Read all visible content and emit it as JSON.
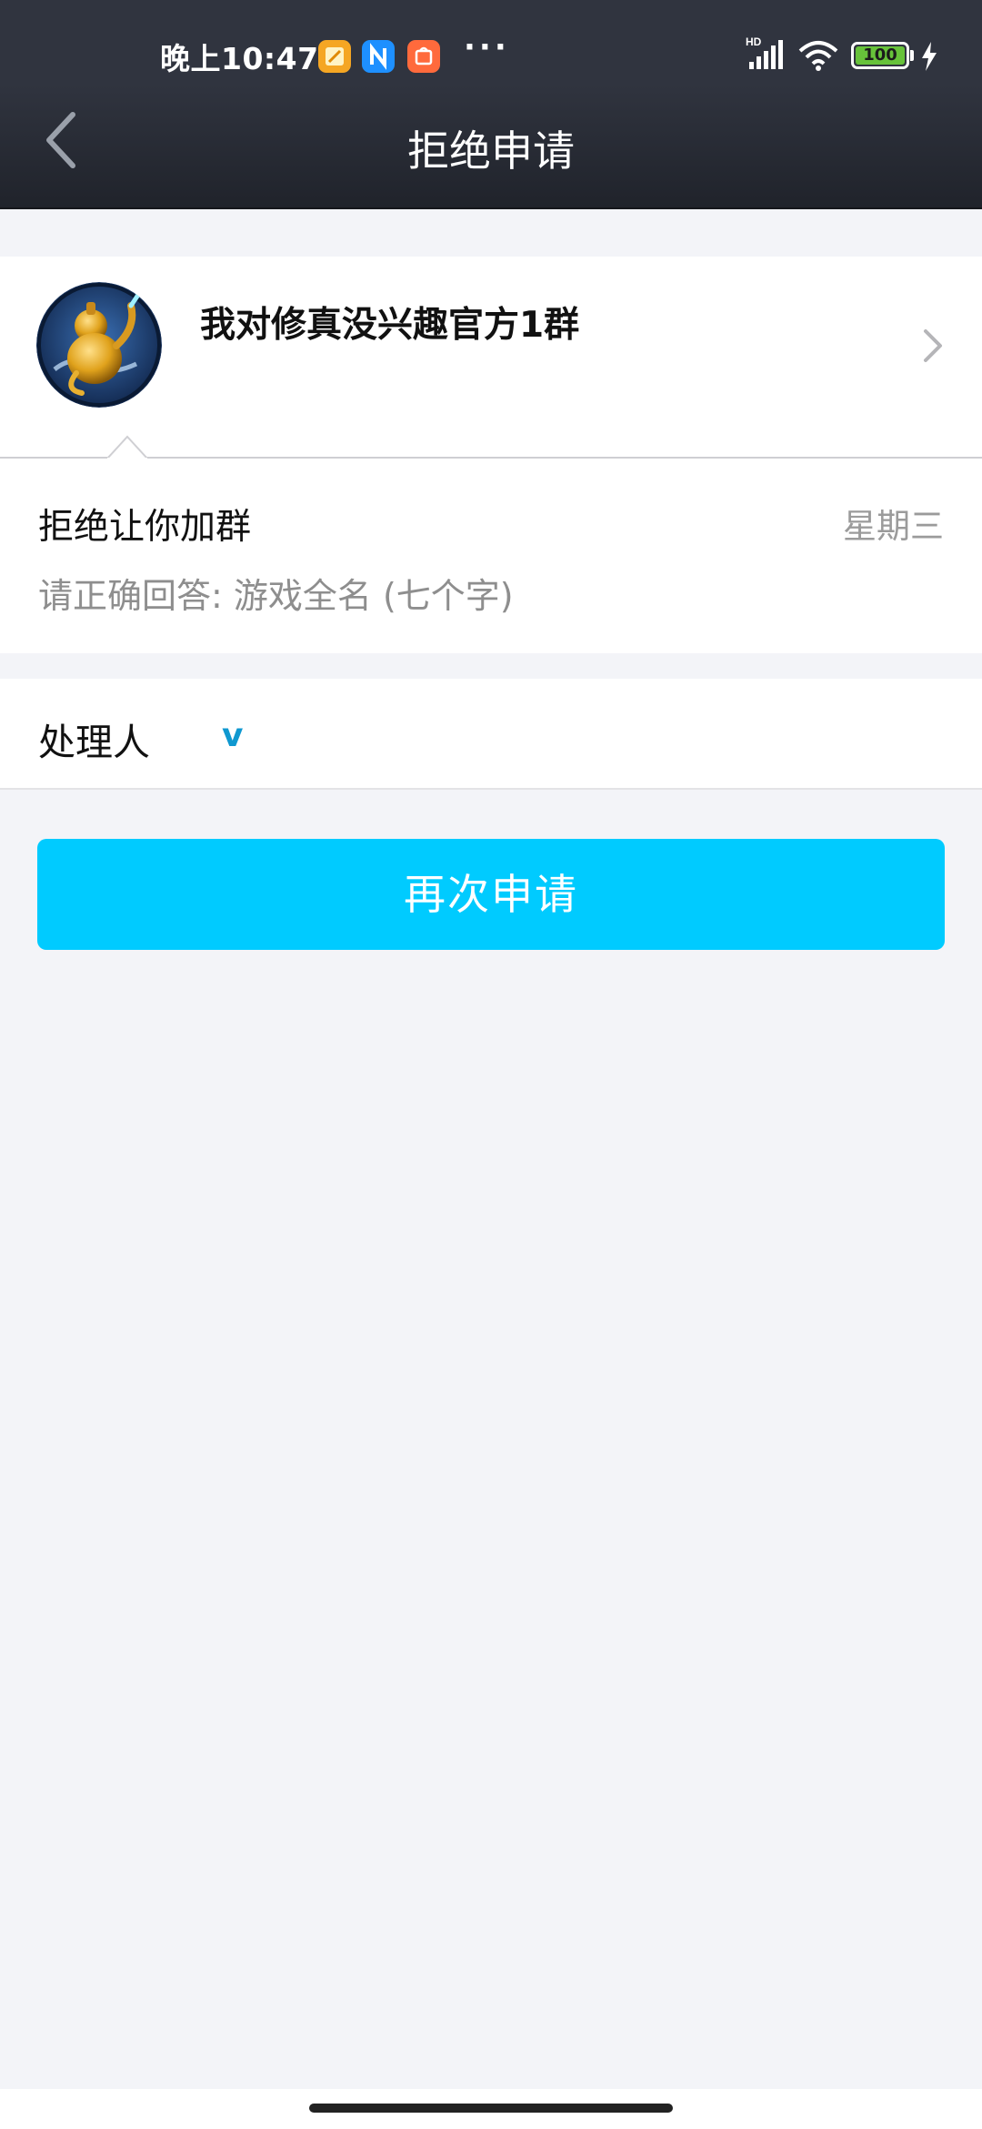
{
  "status_bar": {
    "time": "晚上10:47",
    "more": "···",
    "network": "HD",
    "battery": "100",
    "app_icons": [
      "notes-app-icon",
      "n-app-icon",
      "mi-store-icon"
    ]
  },
  "header": {
    "title": "拒绝申请"
  },
  "group": {
    "name": "我对修真没兴趣官方1群"
  },
  "message": {
    "title": "拒绝让你加群",
    "day": "星期三",
    "question": "请正确回答: 游戏全名 (七个字)"
  },
  "handler": {
    "label": "处理人",
    "name": "v"
  },
  "actions": {
    "reapply_label": "再次申请"
  },
  "colors": {
    "accent": "#00cbff",
    "handler_link": "#0f98d0",
    "header_bg": "#30343f",
    "page_bg": "#f3f4f8"
  }
}
